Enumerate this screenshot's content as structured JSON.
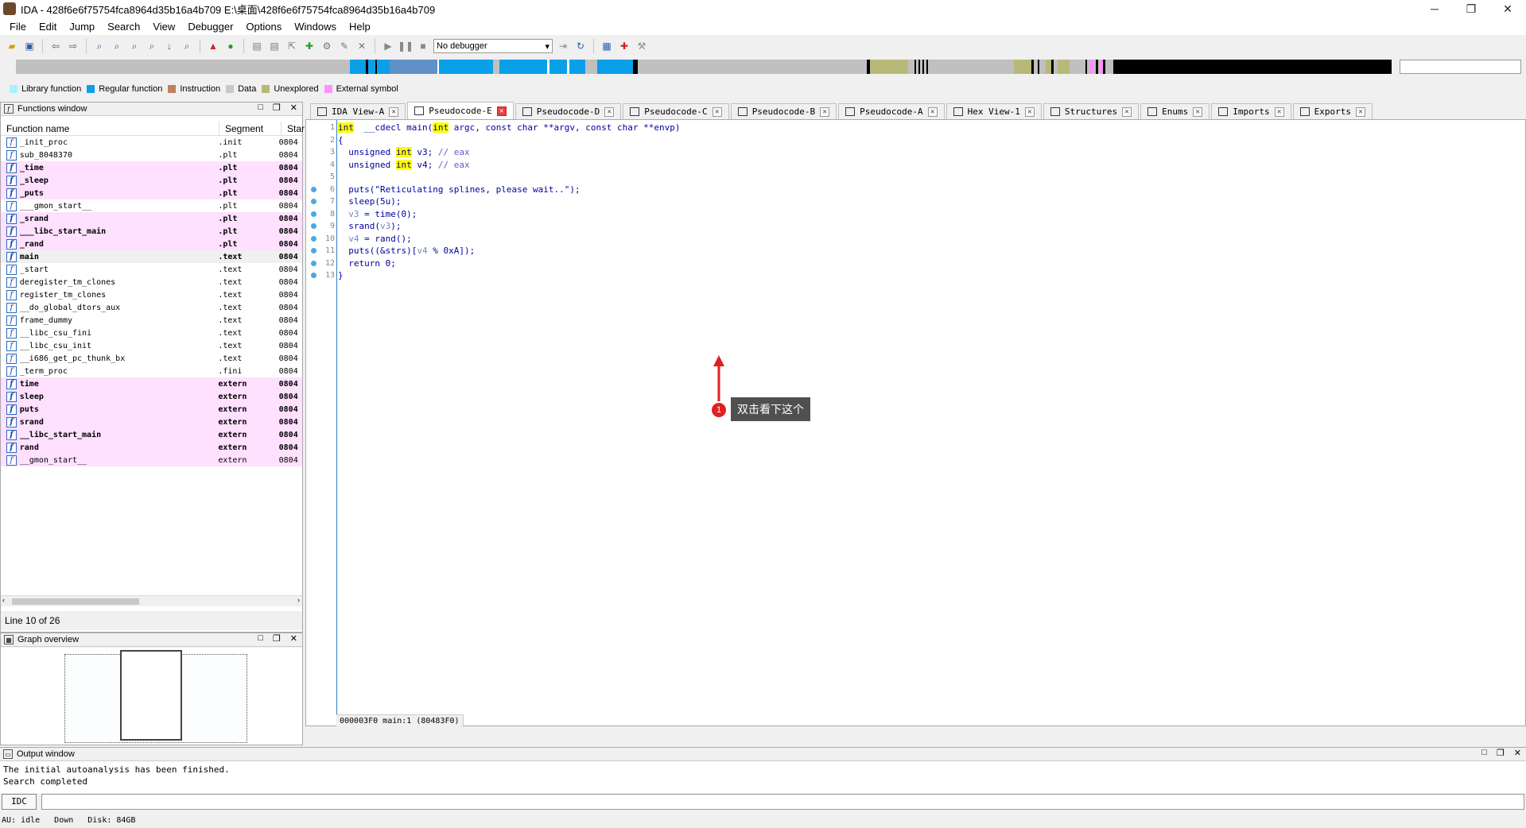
{
  "window": {
    "title": "IDA - 428f6e6f75754fca8964d35b16a4b709 E:\\桌面\\428f6e6f75754fca8964d35b16a4b709",
    "controls": [
      "─",
      "❐",
      "✕"
    ]
  },
  "menu": [
    "File",
    "Edit",
    "Jump",
    "Search",
    "View",
    "Debugger",
    "Options",
    "Windows",
    "Help"
  ],
  "toolbar": {
    "debugger_label": "No debugger"
  },
  "legend": [
    {
      "label": "Library function",
      "color": "#aef0f8"
    },
    {
      "label": "Regular function",
      "color": "#0aa0e8"
    },
    {
      "label": "Instruction",
      "color": "#c08060"
    },
    {
      "label": "Data",
      "color": "#c8c8c8"
    },
    {
      "label": "Unexplored",
      "color": "#b8b878"
    },
    {
      "label": "External symbol",
      "color": "#ff90ff"
    }
  ],
  "functions_window": {
    "title": "Functions window",
    "columns": [
      "Function name",
      "Segment",
      "Star"
    ],
    "rows": [
      {
        "name": "_init_proc",
        "segment": ".init",
        "start": "0804",
        "style": "normal"
      },
      {
        "name": "sub_8048370",
        "segment": ".plt",
        "start": "0804",
        "style": "normal"
      },
      {
        "name": "_time",
        "segment": ".plt",
        "start": "0804",
        "style": "lib"
      },
      {
        "name": "_sleep",
        "segment": ".plt",
        "start": "0804",
        "style": "lib"
      },
      {
        "name": "_puts",
        "segment": ".plt",
        "start": "0804",
        "style": "lib"
      },
      {
        "name": "___gmon_start__",
        "segment": ".plt",
        "start": "0804",
        "style": "normal"
      },
      {
        "name": "_srand",
        "segment": ".plt",
        "start": "0804",
        "style": "lib"
      },
      {
        "name": "___libc_start_main",
        "segment": ".plt",
        "start": "0804",
        "style": "lib"
      },
      {
        "name": "_rand",
        "segment": ".plt",
        "start": "0804",
        "style": "lib"
      },
      {
        "name": "main",
        "segment": ".text",
        "start": "0804",
        "style": "sel"
      },
      {
        "name": "_start",
        "segment": ".text",
        "start": "0804",
        "style": "normal"
      },
      {
        "name": "deregister_tm_clones",
        "segment": ".text",
        "start": "0804",
        "style": "normal"
      },
      {
        "name": "register_tm_clones",
        "segment": ".text",
        "start": "0804",
        "style": "normal"
      },
      {
        "name": "__do_global_dtors_aux",
        "segment": ".text",
        "start": "0804",
        "style": "normal"
      },
      {
        "name": "frame_dummy",
        "segment": ".text",
        "start": "0804",
        "style": "normal"
      },
      {
        "name": "__libc_csu_fini",
        "segment": ".text",
        "start": "0804",
        "style": "normal"
      },
      {
        "name": "__libc_csu_init",
        "segment": ".text",
        "start": "0804",
        "style": "normal"
      },
      {
        "name": "__i686_get_pc_thunk_bx",
        "segment": ".text",
        "start": "0804",
        "style": "normal"
      },
      {
        "name": "_term_proc",
        "segment": ".fini",
        "start": "0804",
        "style": "normal"
      },
      {
        "name": "time",
        "segment": "extern",
        "start": "0804",
        "style": "lib"
      },
      {
        "name": "sleep",
        "segment": "extern",
        "start": "0804",
        "style": "lib"
      },
      {
        "name": "puts",
        "segment": "extern",
        "start": "0804",
        "style": "lib"
      },
      {
        "name": "srand",
        "segment": "extern",
        "start": "0804",
        "style": "lib"
      },
      {
        "name": "__libc_start_main",
        "segment": "extern",
        "start": "0804",
        "style": "lib"
      },
      {
        "name": "rand",
        "segment": "extern",
        "start": "0804",
        "style": "lib"
      },
      {
        "name": "__gmon_start__",
        "segment": "extern",
        "start": "0804",
        "style": "libplain"
      }
    ],
    "status": "Line 10 of 26"
  },
  "graph_overview": {
    "title": "Graph overview"
  },
  "tabs": [
    {
      "label": "IDA View-A",
      "active": false
    },
    {
      "label": "Pseudocode-E",
      "active": true
    },
    {
      "label": "Pseudocode-D",
      "active": false
    },
    {
      "label": "Pseudocode-C",
      "active": false
    },
    {
      "label": "Pseudocode-B",
      "active": false
    },
    {
      "label": "Pseudocode-A",
      "active": false
    },
    {
      "label": "Hex View-1",
      "active": false
    },
    {
      "label": "Structures",
      "active": false
    },
    {
      "label": "Enums",
      "active": false
    },
    {
      "label": "Imports",
      "active": false
    },
    {
      "label": "Exports",
      "active": false
    }
  ],
  "code": [
    {
      "n": "1",
      "bp": false,
      "parts": [
        [
          "kw",
          "int"
        ],
        [
          "",
          "  __cdecl main("
        ],
        [
          "kw",
          "int"
        ],
        [
          "",
          " argc, const char **argv, const char **envp)"
        ]
      ]
    },
    {
      "n": "2",
      "bp": false,
      "parts": [
        [
          "",
          "{"
        ]
      ]
    },
    {
      "n": "3",
      "bp": false,
      "parts": [
        [
          "",
          "  unsigned "
        ],
        [
          "kw",
          "int"
        ],
        [
          "",
          " v3; "
        ],
        [
          "cm",
          "// eax"
        ]
      ]
    },
    {
      "n": "4",
      "bp": false,
      "parts": [
        [
          "",
          "  unsigned "
        ],
        [
          "kw",
          "int"
        ],
        [
          "",
          " v4; "
        ],
        [
          "cm",
          "// eax"
        ]
      ]
    },
    {
      "n": "5",
      "bp": false,
      "parts": [
        [
          "",
          ""
        ]
      ]
    },
    {
      "n": "6",
      "bp": true,
      "parts": [
        [
          "",
          "  puts(\"Reticulating splines, please wait..\");"
        ]
      ]
    },
    {
      "n": "7",
      "bp": true,
      "parts": [
        [
          "",
          "  sleep(5u);"
        ]
      ]
    },
    {
      "n": "8",
      "bp": true,
      "parts": [
        [
          "var",
          "  v3"
        ],
        [
          "",
          " = time(0);"
        ]
      ]
    },
    {
      "n": "9",
      "bp": true,
      "parts": [
        [
          "",
          "  srand("
        ],
        [
          "var",
          "v3"
        ],
        [
          "",
          ");"
        ]
      ]
    },
    {
      "n": "10",
      "bp": true,
      "parts": [
        [
          "var",
          "  v4"
        ],
        [
          "",
          " = rand();"
        ]
      ]
    },
    {
      "n": "11",
      "bp": true,
      "parts": [
        [
          "",
          "  puts((&strs)["
        ],
        [
          "var",
          "v4"
        ],
        [
          "",
          " % 0xA]);"
        ]
      ]
    },
    {
      "n": "12",
      "bp": true,
      "parts": [
        [
          "",
          "  return 0;"
        ]
      ]
    },
    {
      "n": "13",
      "bp": true,
      "parts": [
        [
          "",
          "}"
        ]
      ]
    }
  ],
  "annotation": {
    "number": "1",
    "text": "双击看下这个"
  },
  "editor_status": "000003F0 main:1 (80483F0)",
  "output_window": {
    "title": "Output window",
    "lines": [
      "The initial autoanalysis has been finished.",
      "Search completed"
    ]
  },
  "command": {
    "button_label": "IDC"
  },
  "statusbar": {
    "au": "AU:  idle",
    "direction": "Down",
    "disk": "Disk: 84GB"
  }
}
